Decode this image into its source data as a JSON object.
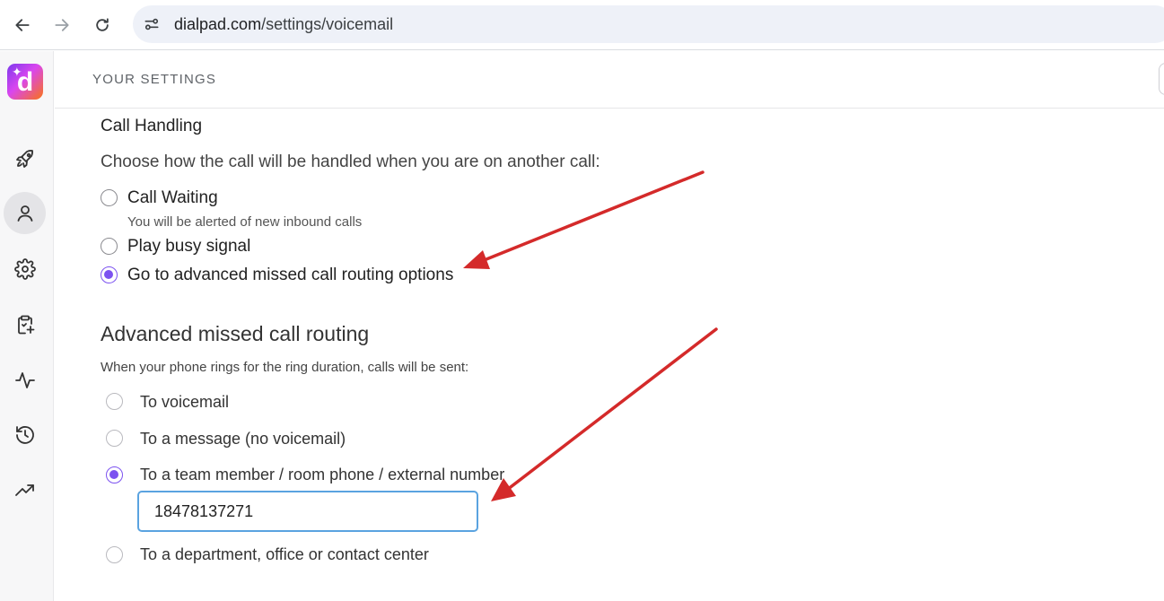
{
  "browser": {
    "url_domain": "dialpad.com",
    "url_path": "/settings/voicemail",
    "icons": [
      "back-arrow-icon",
      "forward-arrow-icon",
      "reload-icon",
      "site-settings-icon"
    ]
  },
  "app": {
    "logo_letter": "d",
    "sidebar_icons": [
      "rocket-icon",
      "user-icon",
      "gear-icon",
      "clipboard-sparkle-icon",
      "activity-pulse-icon",
      "history-icon",
      "trending-up-icon"
    ],
    "active_sidebar_item": "user-icon",
    "accent_color": "#7c52f0"
  },
  "header": {
    "title": "YOUR SETTINGS"
  },
  "call_handling": {
    "label": "Call Handling",
    "description": "Choose how the call will be handled when you are on another call:",
    "options": [
      {
        "label": "Call Waiting",
        "sub": "You will be alerted of new inbound calls",
        "checked": false
      },
      {
        "label": "Play busy signal",
        "checked": false
      },
      {
        "label": "Go to advanced missed call routing options",
        "checked": true
      }
    ]
  },
  "advanced_routing": {
    "title": "Advanced missed call routing",
    "description": "When your phone rings for the ring duration, calls will be sent:",
    "options": [
      {
        "label": "To voicemail",
        "checked": false
      },
      {
        "label": "To a message (no voicemail)",
        "checked": false
      },
      {
        "label": "To a team member / room phone / external number",
        "checked": true
      },
      {
        "label": "To a department, office or contact center",
        "checked": false
      }
    ],
    "external_number_value": "18478137271"
  },
  "annotation_color": "#d42a2a"
}
